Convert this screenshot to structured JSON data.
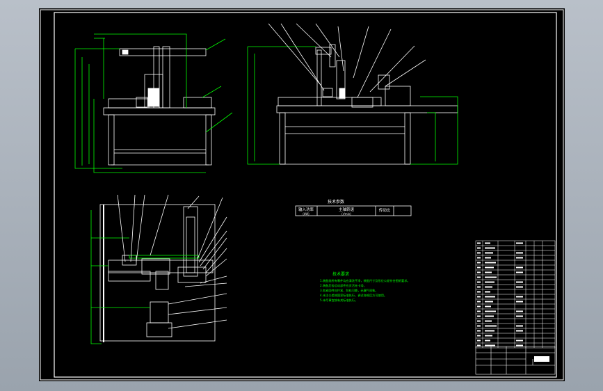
{
  "tech_spec_table": {
    "title": "技术参数",
    "headers": [
      "输入功率",
      "主轴转速",
      "传动比"
    ],
    "units": [
      "(kW)",
      "(r/min)",
      ""
    ]
  },
  "tech_requirements": {
    "title": "技术要求",
    "lines": [
      "1.装配前所有零件均应清洗干净，装配尺寸及形位公差符合图纸要求。",
      "2.装配后各运动部件应灵活无卡滞。",
      "3.各紧固件应拧紧，防松可靠，无漏气现象。",
      "4.未注公差按国家标准执行，调试合格后方可使用。",
      "5.未尽事宜按有关标准执行。"
    ]
  },
  "colors": {
    "background": "#000000",
    "line": "#ffffff",
    "text_annotation": "#00ff00",
    "leader": "#ffffff",
    "centerline": "#ff0000"
  }
}
